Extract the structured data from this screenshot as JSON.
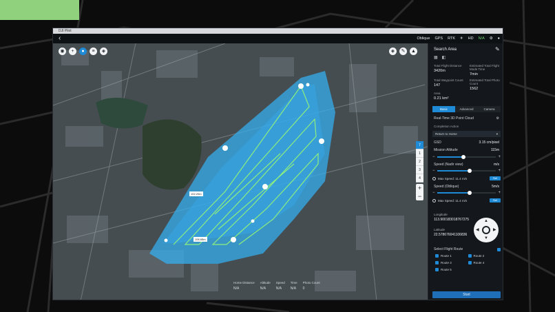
{
  "colors": {
    "accent": "#1f8ad6",
    "route": "#8ef07d",
    "area_fill": "#2aa6ec",
    "corner_accent": "#8fd17c",
    "ok_green": "#69d16d"
  },
  "window": {
    "app_title": "DJI Pilot"
  },
  "topbar": {
    "back_icon": "chevron-left-icon",
    "mode": "Oblique",
    "gps": "GPS",
    "rtk": "RTK",
    "hd": "HD",
    "battery": "N/A",
    "settings_icon": "gear-icon",
    "user_icon": "user-icon"
  },
  "map": {
    "tools_left": [
      "visibility-icon",
      "add-point-icon",
      "location-icon",
      "menu-icon",
      "layers-icon"
    ],
    "tools_right": [
      "layers-icon",
      "edit-icon",
      "direction-icon"
    ],
    "altitude_bar": [
      "7",
      "1",
      "2",
      "3",
      "4"
    ],
    "labels": [
      "102.20m",
      "106.65m"
    ],
    "stats": [
      {
        "label": "Home Distance",
        "value": "N/A"
      },
      {
        "label": "Altitude",
        "value": "N/A"
      },
      {
        "label": "Speed",
        "value": "N/A"
      },
      {
        "label": "Time",
        "value": "N/A"
      },
      {
        "label": "Photo Count",
        "value": "0"
      }
    ]
  },
  "panel": {
    "title": "Search Area",
    "edit_icon": "pen-icon",
    "stats": [
      {
        "label": "Total Flight Distance",
        "value": "3420m"
      },
      {
        "label": "Estimated Total Flight Mode Time",
        "value": "7min"
      },
      {
        "label": "Total Waypoint Count",
        "value": "147"
      },
      {
        "label": "Estimated Total Photo Count",
        "value": "1562"
      },
      {
        "label": "Area",
        "value": "0.21 km²"
      }
    ],
    "tabs": [
      "Basic",
      "Advanced",
      "Camera"
    ],
    "point_cloud": "Real-Time 3D Point Cloud",
    "completion_label": "Completion Action",
    "completion_value": "Return to Home",
    "gsd_label": "GSD",
    "gsd_value": "3.15 cm/pixel",
    "mission_alt_label": "Mission Altitude",
    "mission_alt_value": "115m",
    "mission_alt_level": 0.45,
    "speed_nadir_label": "Speed (Nadir view)",
    "speed_nadir_unit": "m/s",
    "speed_nadir_level": 0.55,
    "max_speed_1": "Max Speed: 11.4 m/s",
    "set_label": "Set",
    "speed_oblique_label": "Speed (Oblique)",
    "speed_oblique_unit": "5m/s",
    "speed_oblique_level": 0.55,
    "max_speed_2": "Max Speed: 11.4 m/s",
    "longitude_label": "Longitude",
    "longitude_value": "113.900183018767275",
    "latitude_label": "Latitude",
    "latitude_value": "22.578676041106836",
    "select_routes_label": "Select Flight Route",
    "routes": [
      "Route 1",
      "Route 2",
      "Route 3",
      "Route 4",
      "Route 5"
    ],
    "start_label": "Start"
  }
}
